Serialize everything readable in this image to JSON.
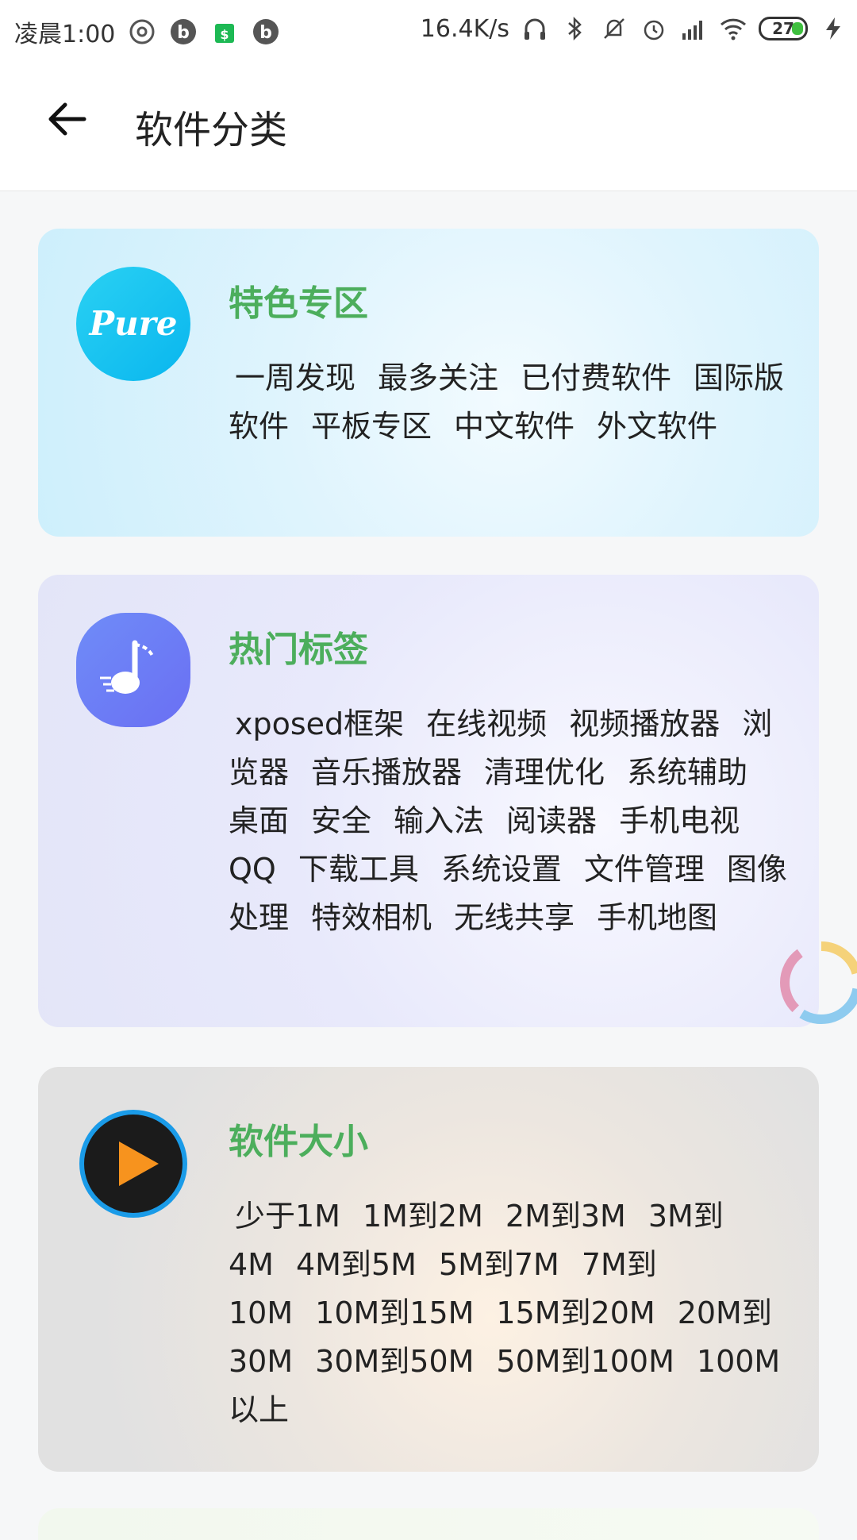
{
  "status_bar": {
    "time": "凌晨1:00",
    "net_speed": "16.4K/s",
    "battery": "27"
  },
  "header": {
    "title": "软件分类"
  },
  "sections": [
    {
      "title": "特色专区",
      "icon_label": "Pure",
      "tags": [
        "一周发现",
        "最多关注",
        "已付费软件",
        "国际版软件",
        "平板专区",
        "中文软件",
        "外文软件"
      ]
    },
    {
      "title": "热门标签",
      "tags": [
        "xposed框架",
        "在线视频",
        "视频播放器",
        "浏览器",
        "音乐播放器",
        "清理优化",
        "系统辅助",
        "桌面",
        "安全",
        "输入法",
        "阅读器",
        "手机电视",
        "QQ",
        "下载工具",
        "系统设置",
        "文件管理",
        "图像处理",
        "特效相机",
        "无线共享",
        "手机地图"
      ]
    },
    {
      "title": "软件大小",
      "tags": [
        "少于1M",
        "1M到2M",
        "2M到3M",
        "3M到4M",
        "4M到5M",
        "5M到7M",
        "7M到10M",
        "10M到15M",
        "15M到20M",
        "20M到30M",
        "30M到50M",
        "50M到100M",
        "100M以上"
      ]
    }
  ],
  "colors": {
    "section_title": "#4cae5c",
    "pure_icon": "#1ec8f0",
    "music_icon": "#6c7cf7",
    "play_icon_ring": "#1a9be8",
    "play_icon_triangle": "#f7931e"
  }
}
